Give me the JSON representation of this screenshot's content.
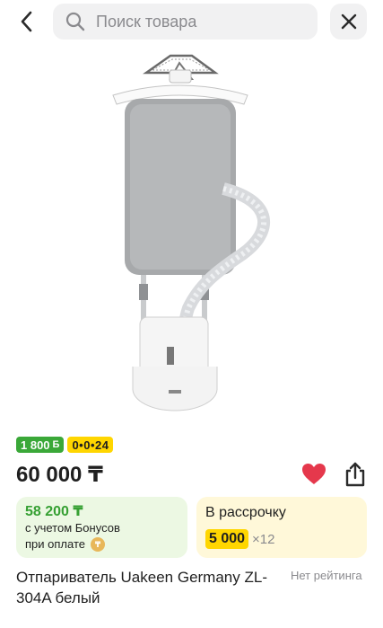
{
  "search": {
    "placeholder": "Поиск товара"
  },
  "icons": {
    "back": "chevron-left-icon",
    "search": "search-icon",
    "close": "close-icon",
    "favorite": "heart-icon",
    "share": "share-icon"
  },
  "badges": {
    "bonus": "1 800",
    "bonus_sign": "Б",
    "installment": "0•0•24"
  },
  "price": "60 000 ₸",
  "bonus_card": {
    "amount": "58 200 ₸",
    "line1": "с учетом Бонусов",
    "line2": "при оплате"
  },
  "installment_card": {
    "title": "В рассрочку",
    "amount": "5 000",
    "times": "×12"
  },
  "product": {
    "name": "Отпариватель Uakeen Germany ZL-304A белый",
    "rating": "Нет рейтинга"
  },
  "colors": {
    "accent_green": "#3aa838",
    "accent_yellow": "#ffd600",
    "heart_red": "#e5384c"
  }
}
